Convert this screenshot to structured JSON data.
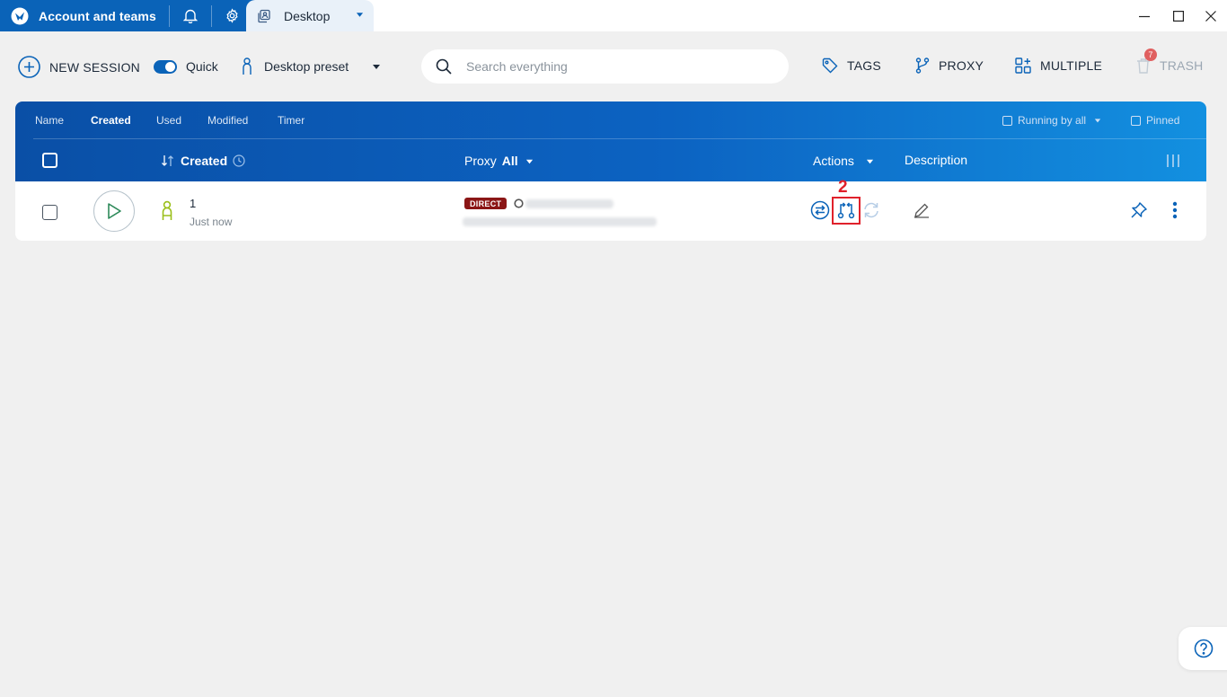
{
  "titlebar": {
    "account_label": "Account and teams",
    "tab_label": "Desktop"
  },
  "toolbar": {
    "new_session_label": "NEW SESSION",
    "quick_label": "Quick",
    "quick_enabled": true,
    "preset_label": "Desktop preset",
    "search_placeholder": "Search everything",
    "tags_label": "TAGS",
    "proxy_label": "PROXY",
    "multiple_label": "MULTIPLE",
    "trash_label": "TRASH",
    "trash_count": "7"
  },
  "table": {
    "sort_tabs": [
      "Name",
      "Created",
      "Used",
      "Modified",
      "Timer"
    ],
    "active_sort": "Created",
    "filters": {
      "running": "Running by all",
      "pinned": "Pinned"
    },
    "columns": {
      "created": "Created",
      "proxy": "Proxy",
      "proxy_filter": "All",
      "actions": "Actions",
      "description": "Description"
    },
    "rows": [
      {
        "name": "1",
        "created": "Just now",
        "proxy_type": "DIRECT"
      }
    ]
  },
  "annotation": {
    "step_number": "2"
  },
  "colors": {
    "brand_blue": "#0a63b8",
    "direct_badge": "#8b1616",
    "highlight_red": "#e0212b",
    "session_icon_green": "#9bbf1a"
  }
}
